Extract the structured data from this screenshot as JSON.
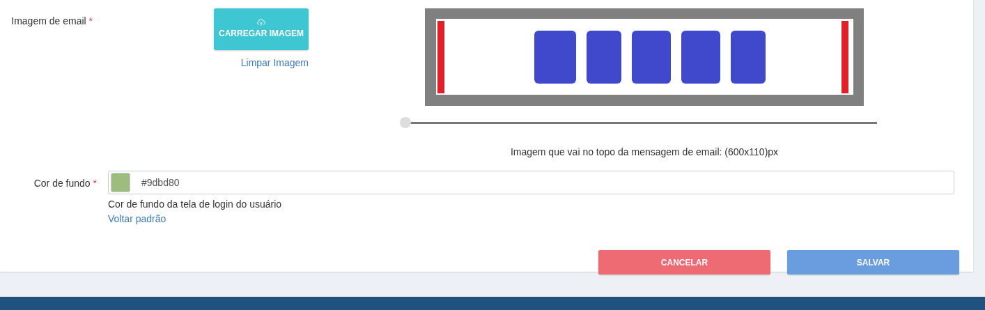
{
  "email_image": {
    "label": "Imagem de email",
    "required_mark": "*",
    "upload_button": "CARREGAR IMAGEM",
    "clear_link": "Limpar Imagem",
    "zoom_slider": {
      "level": 0
    },
    "caption": "Imagem que vai no topo da mensagem de email: (600x110)px"
  },
  "background_color": {
    "label": "Cor de fundo",
    "required_mark": "*",
    "color": "#9dbd80",
    "value": "#9dbd80",
    "help": "Cor de fundo da tela de login do usuário",
    "reset_link": "Voltar padrão"
  },
  "buttons": [
    {
      "label": "CANCELAR",
      "kind": "cancel"
    },
    {
      "label": "SALVAR",
      "kind": "save"
    }
  ]
}
